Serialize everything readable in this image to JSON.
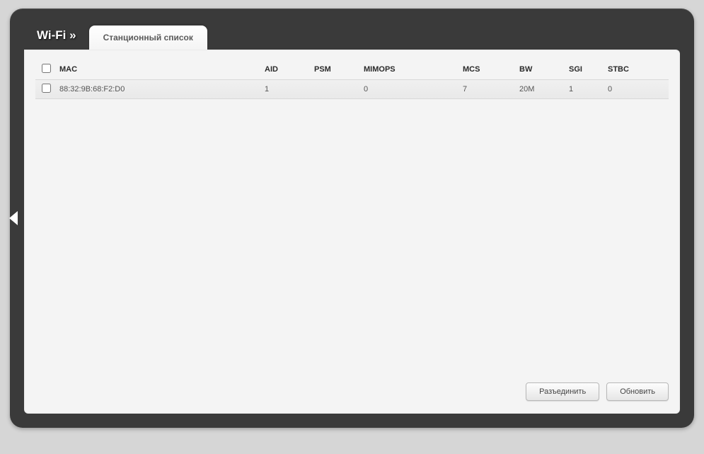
{
  "header": {
    "title": "Wi-Fi »",
    "tab_label": "Станционный список"
  },
  "table": {
    "headers": {
      "mac": "MAC",
      "aid": "AID",
      "psm": "PSM",
      "mimops": "MIMOPS",
      "mcs": "MCS",
      "bw": "BW",
      "sgi": "SGI",
      "stbc": "STBC"
    },
    "rows": [
      {
        "mac": "88:32:9B:68:F2:D0",
        "aid": "1",
        "psm": "",
        "mimops": "0",
        "mcs": "7",
        "bw": "20M",
        "sgi": "1",
        "stbc": "0"
      }
    ]
  },
  "buttons": {
    "disconnect": "Разъединить",
    "refresh": "Обновить"
  }
}
